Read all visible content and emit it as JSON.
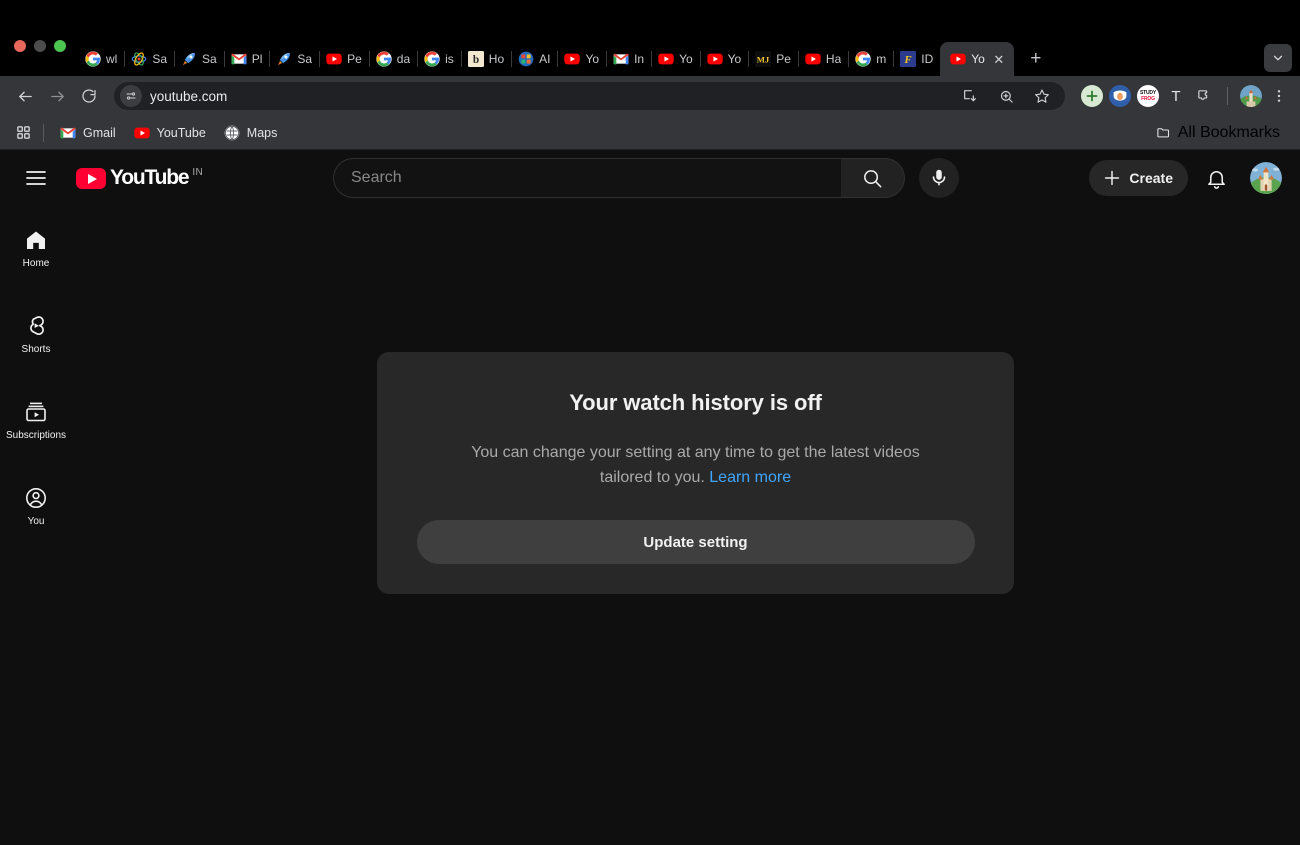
{
  "browser": {
    "tabs": [
      {
        "label": "wl",
        "favicon": "google-g"
      },
      {
        "label": "Sa",
        "favicon": "atom"
      },
      {
        "label": "Sa",
        "favicon": "rocket"
      },
      {
        "label": "Pl",
        "favicon": "gmail"
      },
      {
        "label": "Sa",
        "favicon": "rocket"
      },
      {
        "label": "Pe",
        "favicon": "youtube"
      },
      {
        "label": "da",
        "favicon": "google-g"
      },
      {
        "label": "is",
        "favicon": "google-g"
      },
      {
        "label": "Ho",
        "favicon": "b-cream"
      },
      {
        "label": "AI",
        "favicon": "colorwheel"
      },
      {
        "label": "Yo",
        "favicon": "youtube"
      },
      {
        "label": "In",
        "favicon": "gmail"
      },
      {
        "label": "Yo",
        "favicon": "youtube"
      },
      {
        "label": "Yo",
        "favicon": "youtube"
      },
      {
        "label": "Pe",
        "favicon": "mj"
      },
      {
        "label": "Ha",
        "favicon": "youtube"
      },
      {
        "label": "m",
        "favicon": "google-g"
      },
      {
        "label": "ID",
        "favicon": "f-blue"
      },
      {
        "label": "Yo",
        "favicon": "youtube",
        "active": true,
        "close": "✕"
      }
    ],
    "new_tab_label": "+",
    "tab_search_icon": "chevron-down-icon",
    "toolbar": {
      "back_icon": "back-arrow-icon",
      "forward_icon": "forward-arrow-icon",
      "reload_icon": "reload-icon",
      "site_info_icon": "tune-icon",
      "url": "youtube.com",
      "cast_icon": "install-icon",
      "zoom_icon": "zoom-icon",
      "bookmark_icon": "star-icon",
      "extensions": [
        {
          "name": "plus-extension-icon",
          "color": "#d7e9d2"
        },
        {
          "name": "shield-extension-icon",
          "color": "#2f5fa8"
        },
        {
          "name": "studyfrog-extension-icon",
          "color": "#ffffff",
          "text": "STUDY"
        },
        {
          "name": "text-extension-icon",
          "text": "T"
        },
        {
          "name": "puzzle-extensions-icon"
        }
      ],
      "menu_icon": "kebab-menu-icon"
    },
    "bookmarks": {
      "apps_icon": "apps-grid-icon",
      "items": [
        {
          "label": "Gmail",
          "favicon": "gmail"
        },
        {
          "label": "YouTube",
          "favicon": "youtube"
        },
        {
          "label": "Maps",
          "favicon": "maps"
        }
      ],
      "all_bookmarks_label": "All Bookmarks",
      "all_bookmarks_icon": "folder-icon"
    }
  },
  "youtube": {
    "guide_icon": "hamburger-menu-icon",
    "logo_text": "YouTube",
    "country_code": "IN",
    "search": {
      "placeholder": "Search",
      "search_icon": "search-icon",
      "mic_icon": "microphone-icon"
    },
    "create_label": "Create",
    "create_icon": "plus-icon",
    "notifications_icon": "bell-icon",
    "avatar_name": "user-avatar",
    "sidebar": [
      {
        "label": "Home",
        "icon": "home-icon",
        "selected": true
      },
      {
        "label": "Shorts",
        "icon": "shorts-icon"
      },
      {
        "label": "Subscriptions",
        "icon": "subscriptions-icon"
      },
      {
        "label": "You",
        "icon": "person-icon"
      }
    ],
    "card": {
      "title": "Your watch history is off",
      "description": "You can change your setting at any time to get the latest videos tailored to you.",
      "learn_more": "Learn more",
      "button_label": "Update setting"
    }
  },
  "colors": {
    "page_bg": "#0f0f0f",
    "card_bg": "#282828",
    "button_bg": "#3f3f3f",
    "link_blue": "#3ea6ff",
    "youtube_red": "#ff0033",
    "chrome_toolbar": "#35363a"
  }
}
